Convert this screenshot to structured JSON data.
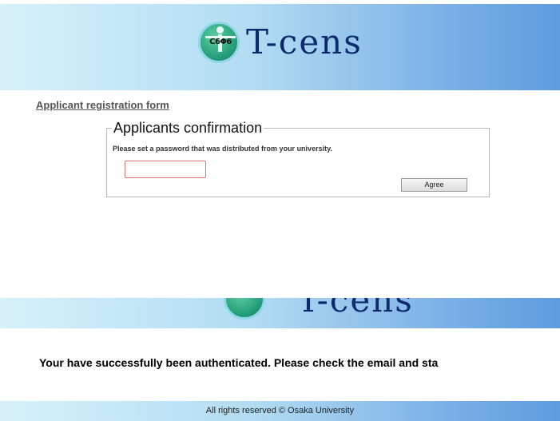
{
  "header": {
    "logo_mark": "C6Φ6",
    "logo_text": "T-cens"
  },
  "registration_link": "Applicant registration form",
  "confirmation": {
    "legend": "Applicants confirmation",
    "instruction": "Please set a password that was distributed from your university.",
    "password_value": "",
    "agree_label": "Agree"
  },
  "second_banner": {
    "logo_text_fragment": "T-cens"
  },
  "success_message": "Your have successfully been authenticated. Please check the email and sta",
  "footer": {
    "text": "All rights reserved © Osaka University"
  },
  "colors": {
    "banner_light": "#d6f1fb",
    "banner_dark": "#5f9be0",
    "logo_green": "#1f9a74",
    "logo_text": "#0e2a6e",
    "input_border": "#e07070"
  }
}
